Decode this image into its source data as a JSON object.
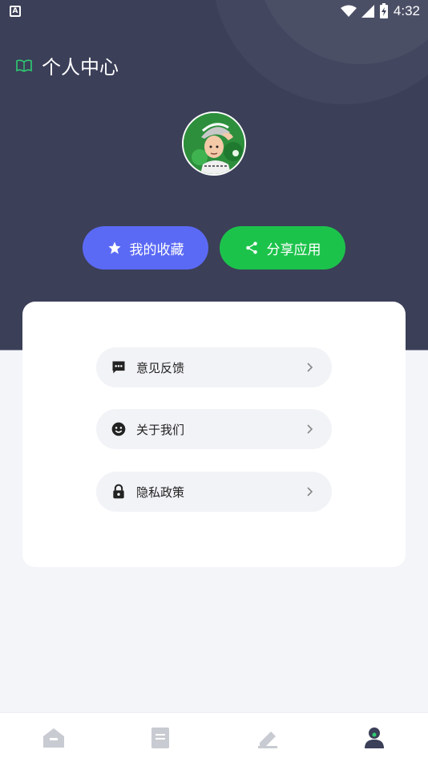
{
  "status_bar": {
    "app_indicator": "A",
    "time": "4:32",
    "battery_charging": true
  },
  "header": {
    "title": "个人中心",
    "book_icon": "book-open-icon"
  },
  "profile": {
    "avatar": "cartoon-character-avatar"
  },
  "actions": {
    "favorites_label": "我的收藏",
    "favorites_icon": "star-icon",
    "share_label": "分享应用",
    "share_icon": "share-icon"
  },
  "menu": [
    {
      "label": "意见反馈",
      "icon": "chat-bubble-icon"
    },
    {
      "label": "关于我们",
      "icon": "smiley-icon"
    },
    {
      "label": "隐私政策",
      "icon": "lock-icon"
    }
  ],
  "bottom_nav": [
    {
      "icon": "home-icon",
      "active": false
    },
    {
      "icon": "document-icon",
      "active": false
    },
    {
      "icon": "edit-icon",
      "active": false
    },
    {
      "icon": "profile-icon",
      "active": true
    }
  ],
  "colors": {
    "header_bg": "#3b3f58",
    "favorites_button": "#5b6af5",
    "share_button": "#1cc34b",
    "page_bg": "#f4f5f9",
    "title_icon_green": "#2ecc71"
  }
}
